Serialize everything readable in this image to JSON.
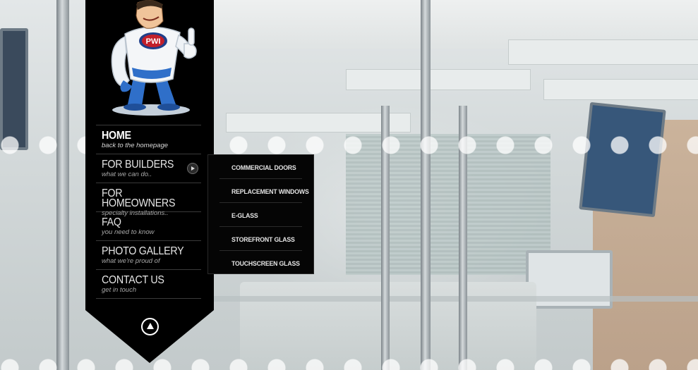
{
  "nav": {
    "items": [
      {
        "title": "HOME",
        "subtitle": "back to the homepage"
      },
      {
        "title": "FOR BUILDERS",
        "subtitle": "what we can do.."
      },
      {
        "title": "FOR HOMEOWNERS",
        "subtitle": "specialty installations.."
      },
      {
        "title": "FAQ",
        "subtitle": "you need to know"
      },
      {
        "title": "PHOTO GALLERY",
        "subtitle": "what we're proud of"
      },
      {
        "title": "CONTACT US",
        "subtitle": "get in touch"
      }
    ],
    "active_item": "HOME"
  },
  "dropdown": {
    "parent": "FOR BUILDERS",
    "items": [
      "COMMERCIAL DOORS",
      "REPLACEMENT WINDOWS",
      "E-GLASS",
      "STOREFRONT GLASS",
      "TOUCHSCREEN GLASS"
    ]
  },
  "mascot": {
    "badge_text": "PWI"
  },
  "icons": {
    "submenu": "chevron-right-circle-icon",
    "back_to_top": "arrow-up-circle-icon"
  },
  "colors": {
    "banner": "#000000",
    "mascot_blue": "#2f6fc9",
    "badge_red": "#c21f2a"
  }
}
